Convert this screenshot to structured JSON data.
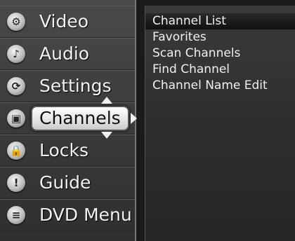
{
  "main_menu": {
    "items": [
      {
        "label": "Video",
        "icon": "video-settings-icon",
        "glyph": "⚙"
      },
      {
        "label": "Audio",
        "icon": "speaker-icon",
        "glyph": "♪"
      },
      {
        "label": "Settings",
        "icon": "settings-icon",
        "glyph": "⟳"
      },
      {
        "label": "Channels",
        "icon": "tv-icon",
        "glyph": "▣"
      },
      {
        "label": "Locks",
        "icon": "lock-icon",
        "glyph": "🔒"
      },
      {
        "label": "Guide",
        "icon": "exclamation-icon",
        "glyph": "!"
      },
      {
        "label": "DVD Menu",
        "icon": "dvd-menu-icon",
        "glyph": "≡"
      }
    ],
    "selected_index": 3
  },
  "submenu": {
    "items": [
      "Channel List",
      "Favorites",
      "Scan Channels",
      "Find Channel",
      "Channel Name Edit"
    ],
    "active_index": 0
  }
}
